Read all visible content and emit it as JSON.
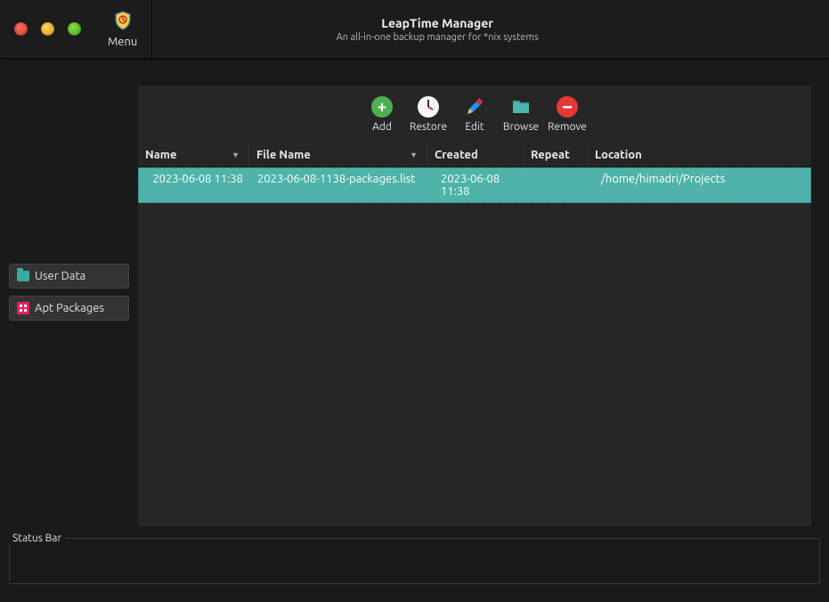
{
  "app": {
    "title": "LeapTime Manager",
    "subtitle": "An all-in-one backup manager for *nix systems",
    "menu_label": "Menu"
  },
  "sidebar": {
    "user_data": "User Data",
    "apt_packages": "Apt Packages"
  },
  "toolbar": {
    "add": "Add",
    "restore": "Restore",
    "edit": "Edit",
    "browse": "Browse",
    "remove": "Remove"
  },
  "table": {
    "headers": {
      "name": "Name",
      "file_name": "File Name",
      "created": "Created",
      "repeat": "Repeat",
      "location": "Location"
    },
    "rows": [
      {
        "name": "2023-06-08 11:38",
        "file_name": "2023-06-08-1138-packages.list",
        "created": "2023-06-08 11:38",
        "repeat": "",
        "location": "/home/himadri/Projects"
      }
    ]
  },
  "status": {
    "label": "Status Bar",
    "text": ""
  }
}
